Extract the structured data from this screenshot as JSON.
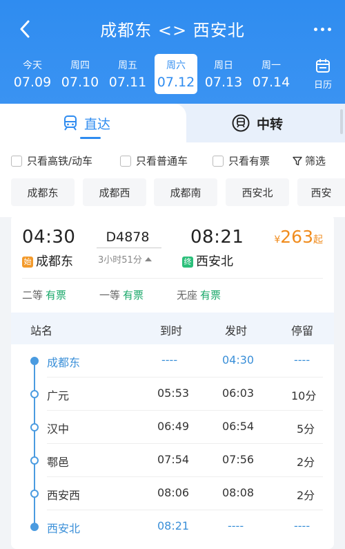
{
  "header": {
    "title": "成都东 <> 西安北",
    "dates": [
      {
        "dow": "今天",
        "md": "07.09",
        "active": false
      },
      {
        "dow": "周四",
        "md": "07.10",
        "active": false
      },
      {
        "dow": "周五",
        "md": "07.11",
        "active": false
      },
      {
        "dow": "周六",
        "md": "07.12",
        "active": true
      },
      {
        "dow": "周日",
        "md": "07.13",
        "active": false
      },
      {
        "dow": "周一",
        "md": "07.14",
        "active": false
      }
    ],
    "calendar_label": "日历"
  },
  "tabs": {
    "direct": "直达",
    "transfer": "中转"
  },
  "filters": {
    "gaotie": "只看高铁/动车",
    "putong": "只看普通车",
    "youpiao": "只看有票",
    "shaixuan": "筛选"
  },
  "station_chips": [
    "成都东",
    "成都西",
    "成都南",
    "西安北",
    "西安"
  ],
  "train": {
    "depart_time": "04:30",
    "depart_station": "成都东",
    "depart_tag": "始",
    "train_no": "D4878",
    "duration": "3小时51分",
    "arrive_time": "08:21",
    "arrive_station": "西安北",
    "arrive_tag": "终",
    "price_symbol": "¥",
    "price": "263",
    "price_suffix": "起",
    "seats": [
      {
        "label": "二等",
        "status": "有票"
      },
      {
        "label": "一等",
        "status": "有票"
      },
      {
        "label": "无座",
        "status": "有票"
      }
    ]
  },
  "stops_table": {
    "headers": {
      "name": "站名",
      "arrive": "到时",
      "depart": "发时",
      "stay": "停留"
    },
    "rows": [
      {
        "name": "成都东",
        "arrive": "----",
        "depart": "04:30",
        "stay": "----"
      },
      {
        "name": "广元",
        "arrive": "05:53",
        "depart": "06:03",
        "stay": "10分"
      },
      {
        "name": "汉中",
        "arrive": "06:49",
        "depart": "06:54",
        "stay": "5分"
      },
      {
        "name": "鄠邑",
        "arrive": "07:54",
        "depart": "07:56",
        "stay": "2分"
      },
      {
        "name": "西安西",
        "arrive": "08:06",
        "depart": "08:08",
        "stay": "2分"
      },
      {
        "name": "西安北",
        "arrive": "08:21",
        "depart": "----",
        "stay": "----"
      }
    ]
  },
  "colors": {
    "primary": "#2f8cf0",
    "price": "#f08c1e",
    "available": "#1aa86a",
    "start_tag": "#f39a2b",
    "end_tag": "#2bbf7a"
  }
}
